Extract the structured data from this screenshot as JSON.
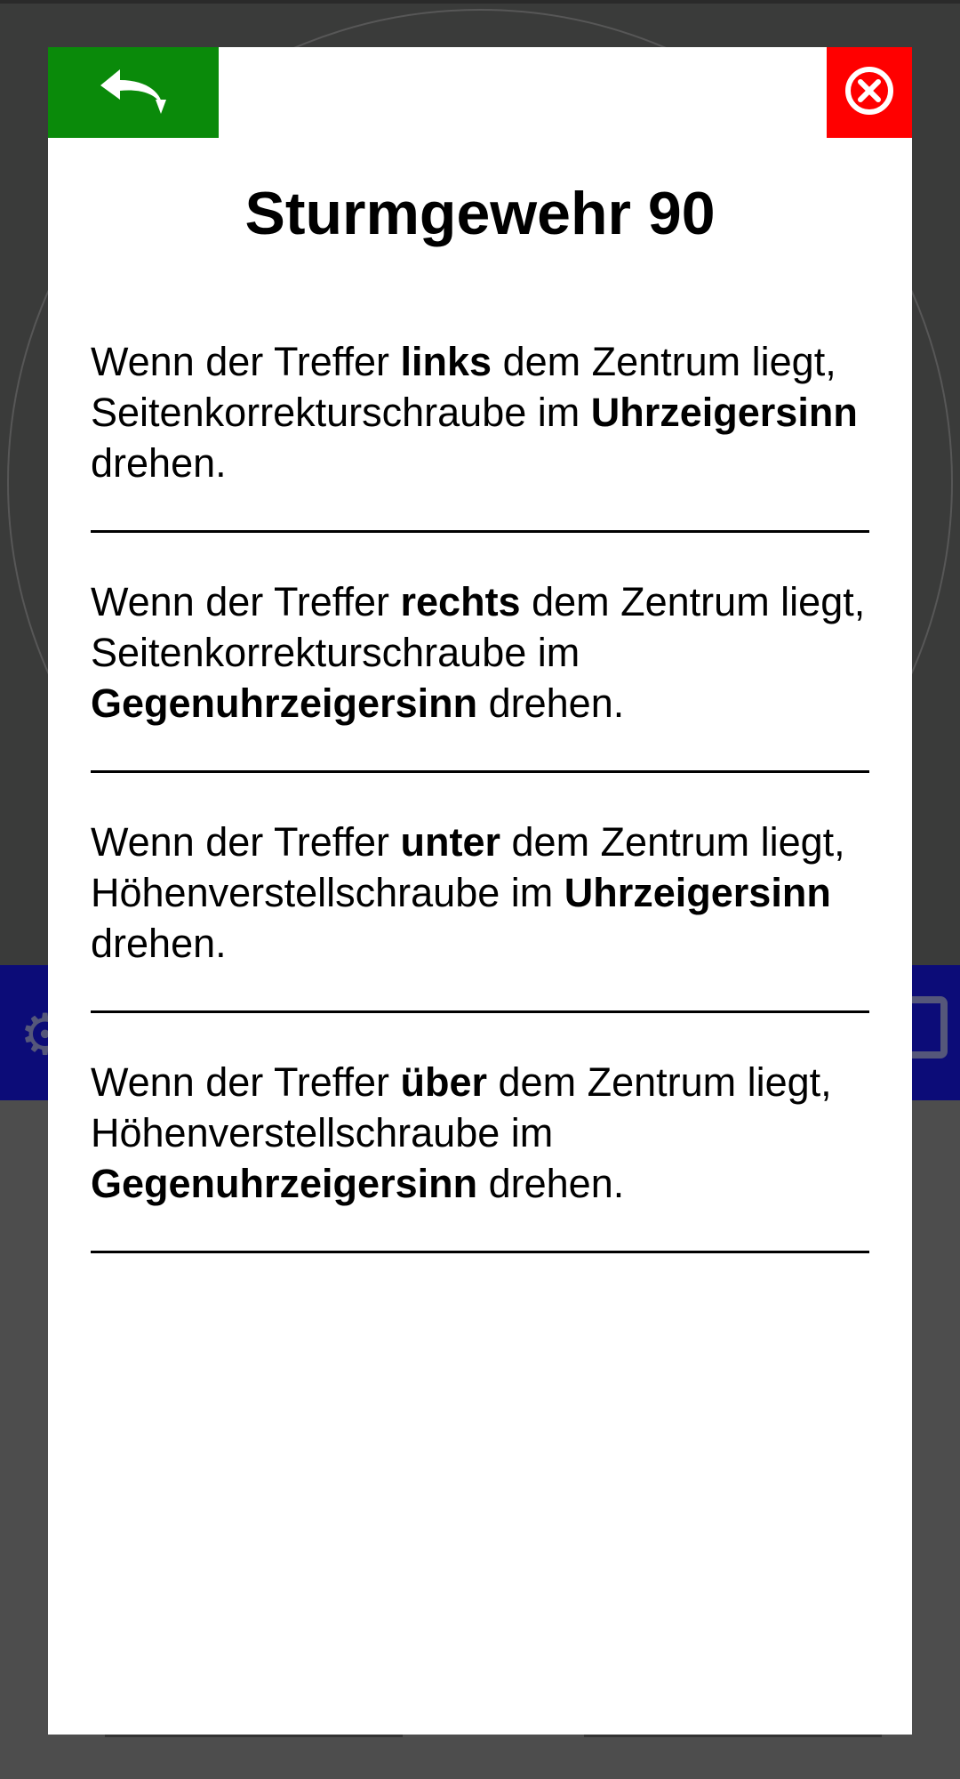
{
  "modal": {
    "title": "Sturmgewehr 90",
    "back_icon": "back-arrow-icon",
    "close_icon": "close-circle-x-icon",
    "colors": {
      "back": "#0a8a0a",
      "close": "#ff0000",
      "bg_bar": "#0c0c78"
    },
    "sections": [
      {
        "pre": "Wenn der Treffer ",
        "dir": "links",
        "mid": " dem Zentrum liegt, Seitenkorrekturschraube im ",
        "rot": "Uhrzeigersinn",
        "post": " drehen."
      },
      {
        "pre": "Wenn der Treffer ",
        "dir": "rechts",
        "mid": " dem Zentrum liegt, Seitenkorrekturschraube im ",
        "rot": "Gegenuhrzeigersinn",
        "post": " drehen."
      },
      {
        "pre": "Wenn der Treffer ",
        "dir": "unter",
        "mid": " dem Zentrum liegt, Höhenverstellschraube im ",
        "rot": "Uhrzeigersinn",
        "post": " drehen."
      },
      {
        "pre": "Wenn der Treffer ",
        "dir": "über",
        "mid": " dem Zentrum liegt, Höhenverstellschraube im ",
        "rot": "Gegenuhrzeigersinn",
        "post": " drehen."
      }
    ]
  },
  "background": {
    "left_icon": "gear-icon",
    "right_icon": "book-icon"
  }
}
